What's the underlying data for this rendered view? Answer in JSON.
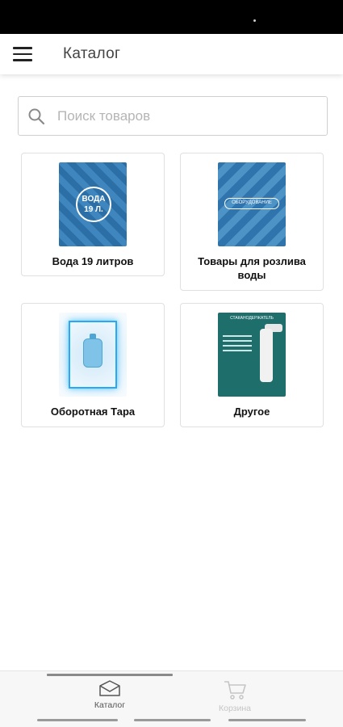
{
  "app_bar": {
    "title": "Каталог",
    "menu_icon": "menu-icon"
  },
  "search": {
    "placeholder": "Поиск товаров",
    "value": "",
    "icon": "search-icon"
  },
  "categories": [
    {
      "label": "Вода 19 литров",
      "image_text": "ВОДА 19 Л."
    },
    {
      "label": "Товары для розлива воды",
      "image_text": "ОБОРУДОВАНИЕ"
    },
    {
      "label": "Оборотная Тара"
    },
    {
      "label": "Другое",
      "image_text": "СТАКАНОДЕРЖАТЕЛЬ"
    }
  ],
  "bottom_nav": {
    "items": [
      {
        "label": "Каталог",
        "icon": "catalog-icon",
        "active": true
      },
      {
        "label": "Корзина",
        "icon": "cart-icon",
        "active": false
      }
    ]
  },
  "colors": {
    "accent": "#2c6fa7",
    "inactive_nav": "#c5c5c5"
  }
}
